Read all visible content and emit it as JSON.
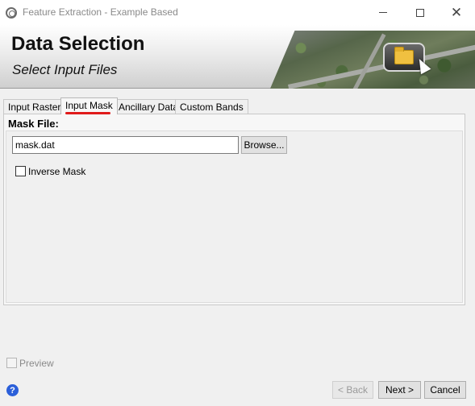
{
  "window": {
    "title": "Feature Extraction - Example Based",
    "minimize_glyph": "",
    "maximize_glyph": "",
    "close_glyph": "✕"
  },
  "banner": {
    "title": "Data Selection",
    "subtitle": "Select Input Files",
    "icon": "folder-icon"
  },
  "tabs": [
    {
      "label": "Input Raster",
      "active": false
    },
    {
      "label": "Input Mask",
      "active": true
    },
    {
      "label": "Ancillary Data",
      "active": false
    },
    {
      "label": "Custom Bands",
      "active": false
    }
  ],
  "mask": {
    "label": "Mask File:",
    "value": "mask.dat",
    "browse_label": "Browse...",
    "inverse_label": "Inverse Mask",
    "inverse_checked": false
  },
  "footer": {
    "preview_label": "Preview",
    "preview_checked": false,
    "help_glyph": "?",
    "back_label": "< Back",
    "next_label": "Next >",
    "cancel_label": "Cancel"
  },
  "colors": {
    "tab_highlight": "#e01b1b",
    "help_icon": "#2b5fd9"
  }
}
